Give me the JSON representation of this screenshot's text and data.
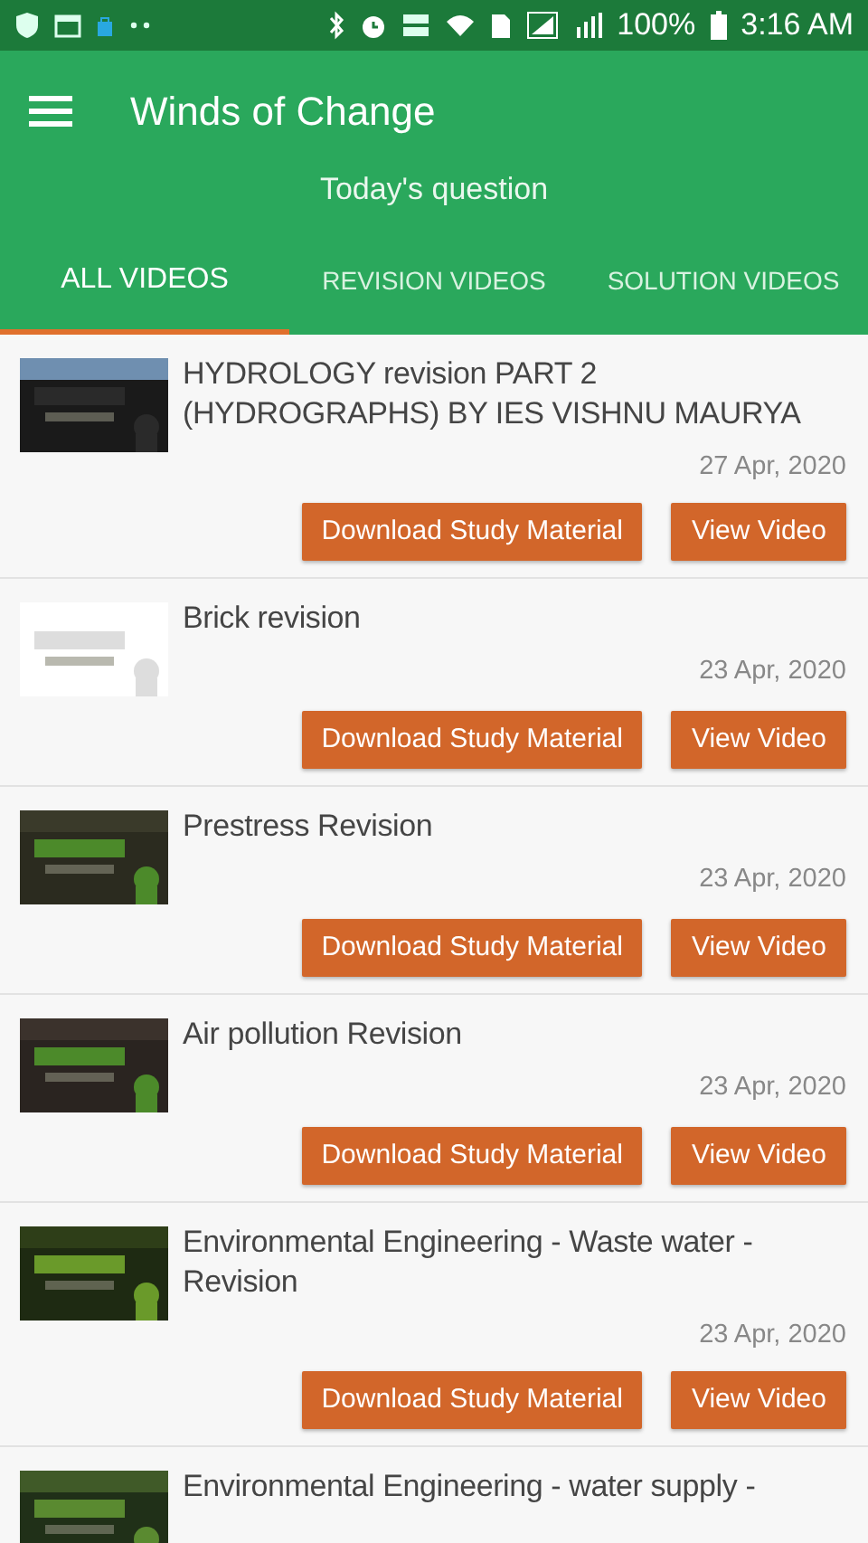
{
  "status_bar": {
    "battery": "100%",
    "time": "3:16 AM"
  },
  "app_bar": {
    "title": "Winds of Change",
    "subtitle": "Today's question"
  },
  "tabs": [
    {
      "label": "ALL VIDEOS",
      "selected": true
    },
    {
      "label": "REVISION VIDEOS",
      "selected": false
    },
    {
      "label": "SOLUTION VIDEOS",
      "selected": false
    }
  ],
  "videos": [
    {
      "title": "HYDROLOGY revision PART 2 (HYDROGRAPHS) BY IES VISHNU MAURYA",
      "date": "27 Apr, 2020",
      "buttons": [
        "Download Study Material",
        "View Video"
      ]
    },
    {
      "title": "Brick revision",
      "date": "23 Apr, 2020",
      "buttons": [
        "Download Study Material",
        "View Video"
      ]
    },
    {
      "title": "Prestress Revision",
      "date": "23 Apr, 2020",
      "buttons": [
        "Download Study Material",
        "View Video"
      ]
    },
    {
      "title": "Air pollution Revision",
      "date": "23 Apr, 2020",
      "buttons": [
        "Download Study Material",
        "View Video"
      ]
    },
    {
      "title": "Environmental Engineering - Waste water - Revision",
      "date": "23 Apr, 2020",
      "buttons": [
        "Download Study Material",
        "View Video"
      ]
    },
    {
      "title": "Environmental Engineering - water supply -"
    }
  ]
}
